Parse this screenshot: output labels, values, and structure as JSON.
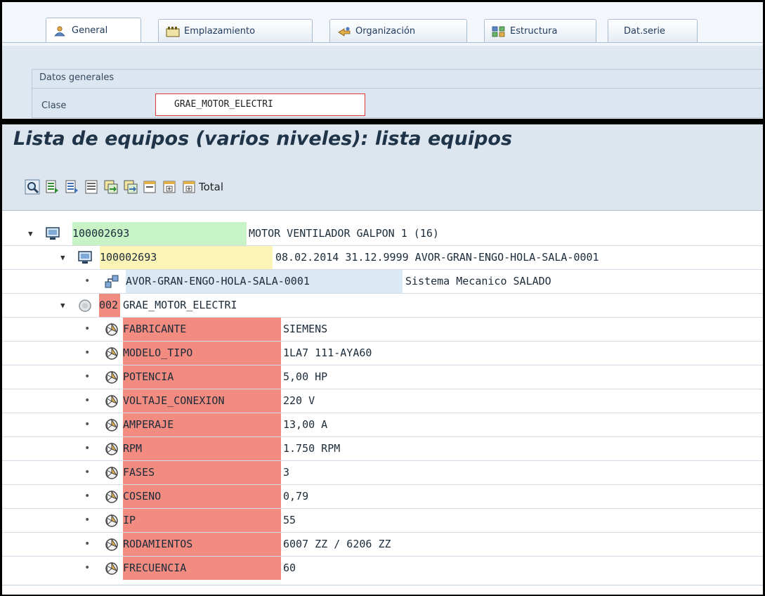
{
  "tabs": [
    {
      "label": "General",
      "icon": "person-icon"
    },
    {
      "label": "Emplazamiento",
      "icon": "location-icon"
    },
    {
      "label": "Organización",
      "icon": "organization-icon"
    },
    {
      "label": "Estructura",
      "icon": "structure-icon"
    },
    {
      "label": "Dat.serie",
      "icon": ""
    }
  ],
  "general_group": {
    "title": "Datos generales",
    "clase_label": "Clase",
    "clase_value": "GRAE_MOTOR_ELECTRI"
  },
  "report": {
    "title": "Lista de equipos (varios niveles): lista equipos",
    "toolbar_total": "Total"
  },
  "tree": {
    "equipment": {
      "id": "100002693",
      "desc": "MOTOR VENTILADOR GALPON 1 (16)"
    },
    "equipment_sub": {
      "id": "100002693",
      "desc": "08.02.2014 31.12.9999 AVOR-GRAN-ENGO-HOLA-SALA-0001"
    },
    "location": {
      "id": "AVOR-GRAN-ENGO-HOLA-SALA-0001",
      "desc": "Sistema Mecanico SALADO"
    },
    "class": {
      "code": "002",
      "name": "GRAE_MOTOR_ELECTRI"
    },
    "characteristics": [
      {
        "name": "FABRICANTE",
        "value": "SIEMENS"
      },
      {
        "name": "MODELO_TIPO",
        "value": "1LA7 111-AYA60"
      },
      {
        "name": "POTENCIA",
        "value": "5,00 HP"
      },
      {
        "name": "VOLTAJE_CONEXION",
        "value": "220 V"
      },
      {
        "name": "AMPERAJE",
        "value": "13,00 A"
      },
      {
        "name": "RPM",
        "value": "1.750 RPM"
      },
      {
        "name": "FASES",
        "value": "3"
      },
      {
        "name": "COSENO",
        "value": "0,79"
      },
      {
        "name": "IP",
        "value": "55"
      },
      {
        "name": "RODAMIENTOS",
        "value": "6007 ZZ / 6206 ZZ"
      },
      {
        "name": "FRECUENCIA",
        "value": "60"
      }
    ]
  },
  "colors": {
    "highlight_green": "#c7f3c7",
    "highlight_yellow": "#fbf4b6",
    "highlight_red": "#f28b80",
    "input_border": "#e53935"
  }
}
